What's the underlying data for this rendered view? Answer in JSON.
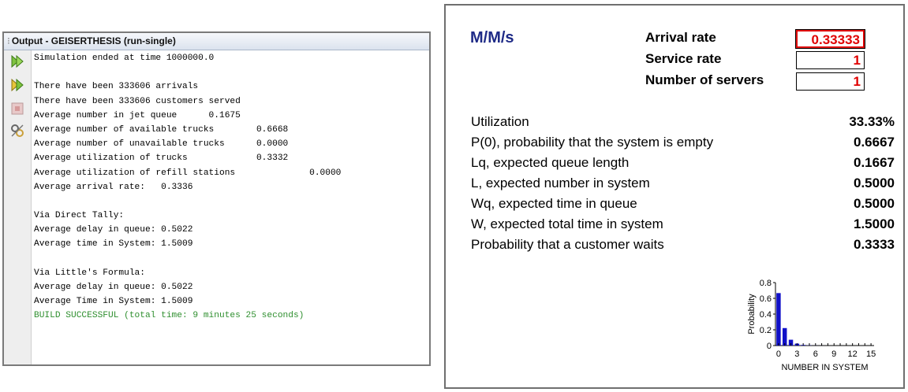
{
  "output_window": {
    "title": "Output - GEISERTHESIS (run-single)",
    "lines": [
      "Simulation ended at time 1000000.0",
      "",
      "There have been 333606 arrivals",
      "There have been 333606 customers served",
      "Average number in jet queue      0.1675",
      "Average number of available trucks        0.6668",
      "Average number of unavailable trucks      0.0000",
      "Average utilization of trucks             0.3332",
      "Average utilization of refill stations              0.0000",
      "Average arrival rate:   0.3336",
      "",
      "Via Direct Tally:",
      "Average delay in queue: 0.5022",
      "Average time in System: 1.5009",
      "",
      "Via Little's Formula:",
      "Average delay in queue: 0.5022",
      "Average Time in System: 1.5009",
      "BUILD SUCCESSFUL (total time: 9 minutes 25 seconds)"
    ],
    "toolbar_icons": [
      "rerun-icon",
      "rerun-with-options-icon",
      "stop-icon",
      "settings-icon"
    ]
  },
  "mms": {
    "title": "M/M/s",
    "params": [
      {
        "label": "Arrival rate",
        "value": "0.33333"
      },
      {
        "label": "Service rate",
        "value": "1"
      },
      {
        "label": "Number of servers",
        "value": "1"
      }
    ],
    "results": [
      {
        "label": "Utilization",
        "value": "33.33%"
      },
      {
        "label": "P(0), probability that the system is empty",
        "value": "0.6667"
      },
      {
        "label": "Lq, expected queue length",
        "value": "0.1667"
      },
      {
        "label": "L, expected number in system",
        "value": "0.5000"
      },
      {
        "label": "Wq, expected time in queue",
        "value": "0.5000"
      },
      {
        "label": "W, expected total time in system",
        "value": "1.5000"
      },
      {
        "label": "Probability that a customer waits",
        "value": "0.3333"
      }
    ]
  },
  "chart_data": {
    "type": "bar",
    "x": [
      0,
      1,
      2,
      3,
      4,
      5,
      6,
      7,
      8,
      9,
      10,
      11,
      12,
      13,
      14,
      15
    ],
    "values": [
      0.6667,
      0.2222,
      0.0741,
      0.0247,
      0.0082,
      0.0027,
      0.0009,
      0.0003,
      0.0001,
      0,
      0,
      0,
      0,
      0,
      0,
      0
    ],
    "xlabel": "NUMBER IN SYSTEM",
    "ylabel": "Probability",
    "xticks": [
      "0",
      "3",
      "6",
      "9",
      "12",
      "15"
    ],
    "yticks": [
      "0",
      "0.2",
      "0.4",
      "0.6",
      "0.8"
    ],
    "ylim": [
      0,
      0.8
    ],
    "bar_color": "#1010c8"
  }
}
